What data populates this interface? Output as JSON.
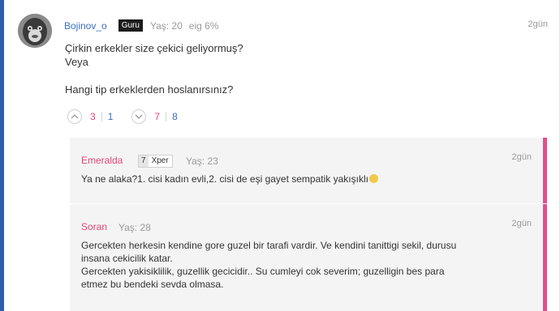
{
  "post": {
    "username": "Bojinov_o",
    "badge": "Guru",
    "age": "Yaş: 20",
    "eig": "eig 6%",
    "time": "2gün",
    "lines": [
      "Çirkin erkekler size çekici geliyormuş?",
      "Veya",
      "",
      "Hangi tip erkeklerden hoslanırsınız?"
    ],
    "votes": {
      "option1_pink": "3",
      "option1_blue": "1",
      "option2_pink": "7",
      "option2_blue": "8"
    }
  },
  "replies": [
    {
      "username": "Emeralda",
      "xper_level": "7",
      "xper_label": "Xper",
      "age": "Yaş: 23",
      "time": "2gün",
      "text": "Ya ne alaka?1. cisi kadın evli,2. cisi de eşi gayet sempatik yakışıklı"
    },
    {
      "username": "Soran",
      "age": "Yaş: 28",
      "time": "2gün",
      "lines": [
        "Gercekten herkesin kendine gore guzel bir tarafi vardir. Ve kendini tanittigi sekil, durusu",
        "insana cekicilik katar.",
        "Gercekten yakisiklilik, guzellik gecicidir.. Su cumleyi cok severim; guzelligin bes para",
        "etmez bu bendeki sevda olmasa."
      ]
    }
  ],
  "colors": {
    "accent_blue": "#2f5ea8",
    "username_blue": "#3b6fc4",
    "pink": "#e2457a",
    "reply_bar": "#e14e8f"
  }
}
